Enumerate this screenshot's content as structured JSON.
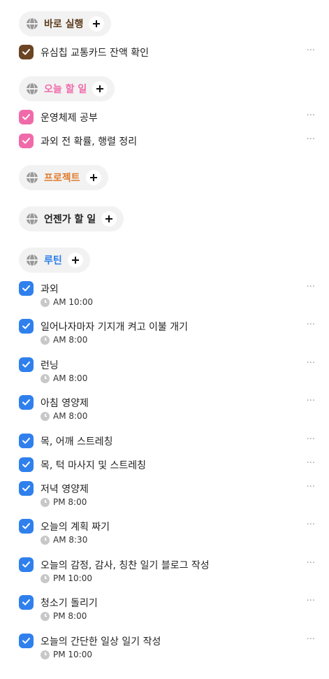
{
  "colors": {
    "group_bg": "#f2f2f2",
    "section1": "#5c3d1e",
    "section2": "#f06aa9",
    "section3": "#e07b2c",
    "section4": "#222222",
    "section5": "#2b7de9",
    "check_brown": "#6b4423",
    "check_pink": "#f06aa9",
    "check_blue": "#2f80ed"
  },
  "sections": [
    {
      "title": "바로 실행"
    },
    {
      "title": "오늘 할 일"
    },
    {
      "title": "프로젝트"
    },
    {
      "title": "언젠가 할 일"
    },
    {
      "title": "루틴"
    }
  ],
  "immediate_tasks": [
    {
      "label": "유심칩 교통카드 잔액 확인"
    }
  ],
  "today_tasks": [
    {
      "label": "운영체제 공부"
    },
    {
      "label": "과외 전 확률, 행렬 정리"
    }
  ],
  "routine_tasks": [
    {
      "label": "과외",
      "time": "AM 10:00"
    },
    {
      "label": "일어나자마자 기지개 켜고 이불 개기",
      "time": "AM 8:00"
    },
    {
      "label": "런닝",
      "time": "AM 8:00"
    },
    {
      "label": "아침 영양제",
      "time": "AM 8:00"
    },
    {
      "label": "목, 어깨 스트레칭"
    },
    {
      "label": "목, 턱 마사지 및 스트레칭"
    },
    {
      "label": "저녁 영양제",
      "time": "PM 8:00"
    },
    {
      "label": "오늘의 계획 짜기",
      "time": "AM 8:30"
    },
    {
      "label": "오늘의 감정, 감사, 칭찬 일기 블로그 작성",
      "time": "PM 10:00"
    },
    {
      "label": "청소기 돌리기",
      "time": "PM 8:00"
    },
    {
      "label": "오늘의 간단한 일상 일기 작성",
      "time": "PM 10:00"
    }
  ],
  "more_label": "···",
  "icons": {
    "section": "globe-icon",
    "add": "plus-icon",
    "check": "checkmark-icon",
    "time": "clock-icon",
    "more": "more-horizontal-icon"
  }
}
